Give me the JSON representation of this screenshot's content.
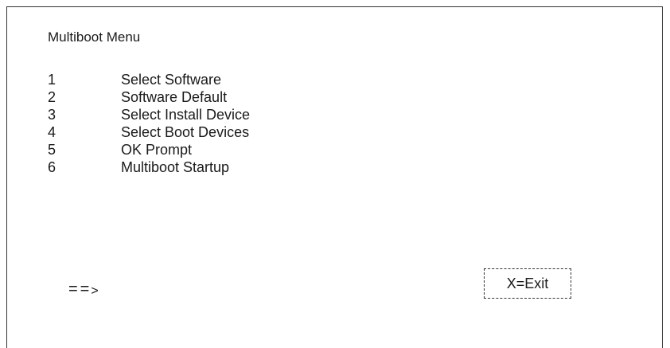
{
  "menu": {
    "title": "Multiboot Menu",
    "items": [
      {
        "number": "1",
        "label": "Select Software"
      },
      {
        "number": "2",
        "label": "Software Default"
      },
      {
        "number": "3",
        "label": "Select Install Device"
      },
      {
        "number": "4",
        "label": "Select Boot Devices"
      },
      {
        "number": "5",
        "label": "OK Prompt"
      },
      {
        "number": "6",
        "label": "Multiboot Startup"
      }
    ]
  },
  "prompt": {
    "equals": "==",
    "arrow": ">"
  },
  "exit_button": {
    "label": "X=Exit"
  }
}
